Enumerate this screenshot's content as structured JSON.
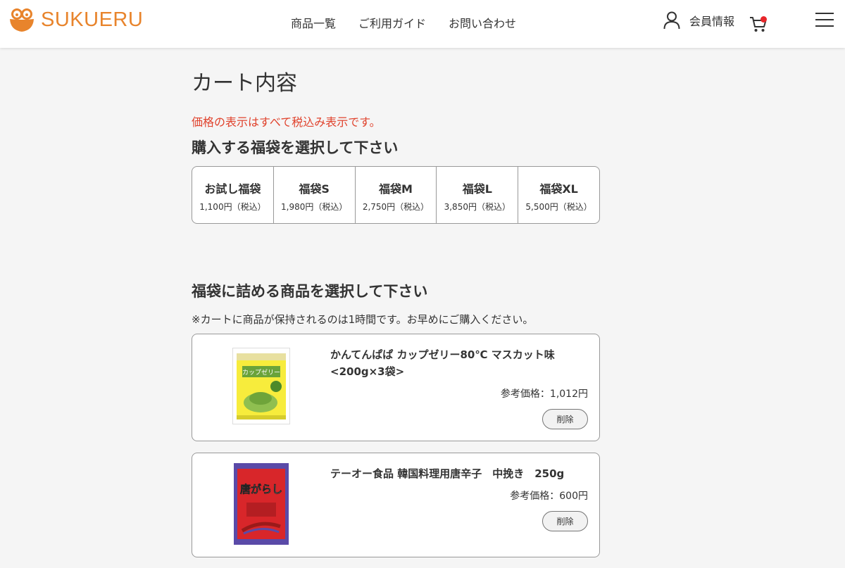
{
  "header": {
    "logo_text": "SUKUERU",
    "nav": [
      "商品一覧",
      "ご利用ガイド",
      "お問い合わせ"
    ],
    "member_label": "会員情報"
  },
  "main": {
    "title": "カート内容",
    "tax_note": "価格の表示はすべて税込み表示です。",
    "select_bag_heading": "購入する福袋を選択して下さい",
    "bags": [
      {
        "name": "お試し福袋",
        "price": "1,100円（税込）"
      },
      {
        "name": "福袋S",
        "price": "1,980円（税込）"
      },
      {
        "name": "福袋M",
        "price": "2,750円（税込）"
      },
      {
        "name": "福袋L",
        "price": "3,850円（税込）"
      },
      {
        "name": "福袋XL",
        "price": "5,500円（税込）"
      }
    ],
    "select_items_heading": "福袋に詰める商品を選択して下さい",
    "hold_note": "※カートに商品が保持されるのは1時間です。お早めにご購入ください。",
    "items": [
      {
        "name": "かんてんぱぱ カップゼリー80℃ マスカット味 <200g×3袋>",
        "price": "参考価格：1,012円",
        "delete_label": "削除",
        "package_text": "カップゼリー"
      },
      {
        "name": "テーオー食品 韓国料理用唐辛子　中挽き　250g",
        "price": "参考価格：600円",
        "delete_label": "削除",
        "package_text": "唐がらし"
      }
    ]
  },
  "colors": {
    "accent": "#e8842c",
    "notice": "#e0422c",
    "cart_badge": "#e8262a"
  }
}
